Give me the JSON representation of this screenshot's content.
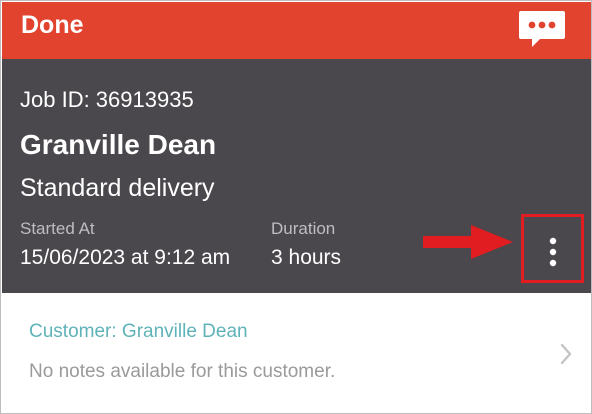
{
  "status": {
    "title": "Done",
    "color": "#e2432f",
    "chat_icon": "chat-bubble-icon"
  },
  "job": {
    "id_label": "Job ID: 36913935",
    "customer_name": "Granville Dean",
    "job_type": "Standard delivery",
    "started_at_label": "Started At",
    "started_at_value": "15/06/2023 at 9:12 am",
    "duration_label": "Duration",
    "duration_value": "3 hours",
    "more_icon": "more-vertical-icon",
    "panel_color": "#4a484c"
  },
  "annotation": {
    "arrow_icon": "arrow-right-icon",
    "highlight_color": "#e21d22"
  },
  "customer_notes": {
    "title": "Customer: Granville Dean",
    "text": "No notes available for this customer.",
    "title_color": "#5fb3b8",
    "chevron_icon": "chevron-right-icon"
  }
}
